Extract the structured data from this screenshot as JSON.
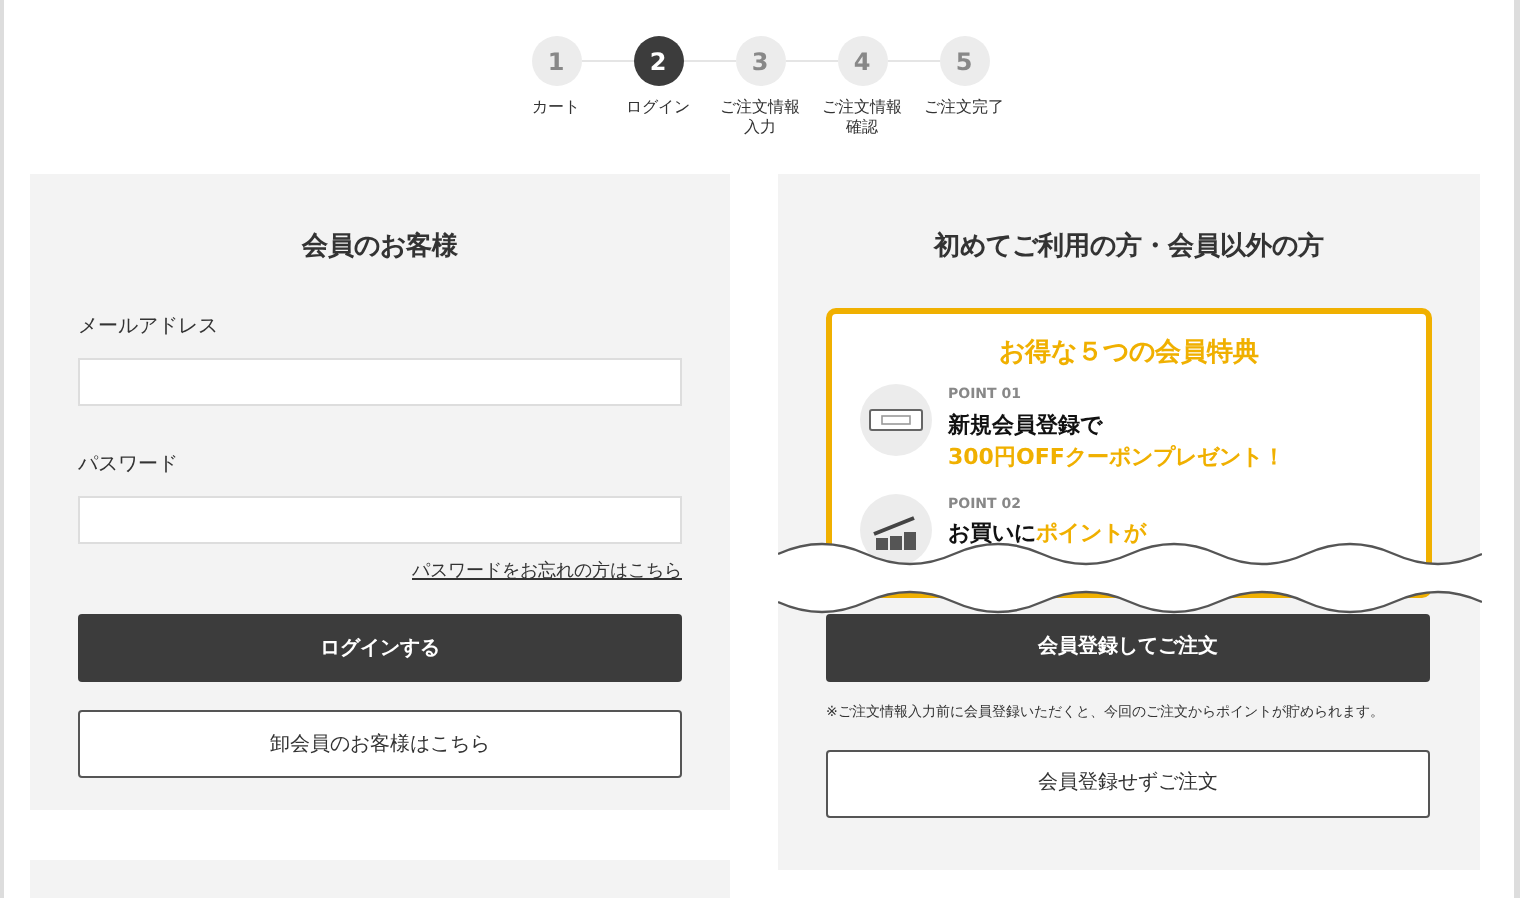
{
  "steps": [
    {
      "number": "1",
      "label": "カート",
      "current": false
    },
    {
      "number": "2",
      "label": "ログイン",
      "current": true
    },
    {
      "number": "3",
      "label": "ご注文情報入力",
      "current": false
    },
    {
      "number": "4",
      "label": "ご注文情報確認",
      "current": false
    },
    {
      "number": "5",
      "label": "ご注文完了",
      "current": false
    }
  ],
  "member_login": {
    "title": "会員のお客様",
    "email_label": "メールアドレス",
    "password_label": "パスワード",
    "forgot_link": "パスワードをお忘れの方はこちら",
    "login_button": "ログインする",
    "wholesale_button": "卸会員のお客様はこちら"
  },
  "guest": {
    "title": "初めてご利用の方・会員以外の方",
    "benefits": {
      "title": "お得な５つの会員特典",
      "points": [
        {
          "kind": "ticket",
          "label": "POINT 01",
          "lines": [
            [
              {
                "text": "新規会員登録で",
                "highlight": false
              }
            ],
            [
              {
                "text": "300円OFFクーポンプレゼント！",
                "highlight": true
              }
            ]
          ]
        },
        {
          "kind": "coins",
          "label": "POINT 02",
          "lines": [
            [
              {
                "text": "お買い",
                "highlight": false
              },
              {
                "text": "に",
                "highlight": false
              },
              {
                "text": "ポイントが",
                "highlight": true
              }
            ]
          ]
        }
      ]
    },
    "register_button": "会員登録してご注文",
    "note": "※ご注文情報入力前に会員登録いただくと、今回のご注文からポイントが貯められます。",
    "guest_button": "会員登録せずご注文"
  }
}
